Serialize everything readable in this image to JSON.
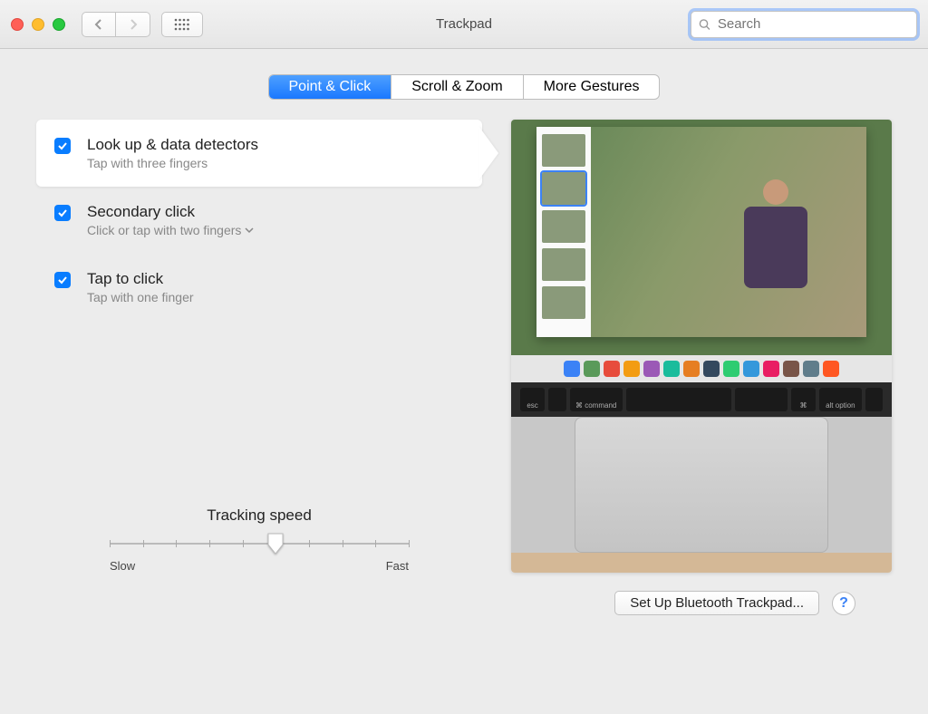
{
  "window": {
    "title": "Trackpad"
  },
  "search": {
    "placeholder": "Search"
  },
  "tabs": [
    {
      "label": "Point & Click",
      "active": true
    },
    {
      "label": "Scroll & Zoom",
      "active": false
    },
    {
      "label": "More Gestures",
      "active": false
    }
  ],
  "options": [
    {
      "title": "Look up & data detectors",
      "subtitle": "Tap with three fingers",
      "checked": true,
      "selected": true,
      "dropdown": false
    },
    {
      "title": "Secondary click",
      "subtitle": "Click or tap with two fingers",
      "checked": true,
      "selected": false,
      "dropdown": true
    },
    {
      "title": "Tap to click",
      "subtitle": "Tap with one finger",
      "checked": true,
      "selected": false,
      "dropdown": false
    }
  ],
  "speed": {
    "label": "Tracking speed",
    "min_label": "Slow",
    "max_label": "Fast",
    "ticks": 10,
    "value_index": 5
  },
  "preview": {
    "keyboard_keys": [
      "esc",
      "",
      "⌘ command",
      "",
      "",
      "⌘",
      "alt option",
      ""
    ],
    "dock_colors": [
      "#3b82f6",
      "#5a9a5a",
      "#e74c3c",
      "#f39c12",
      "#9b59b6",
      "#1abc9c",
      "#e67e22",
      "#34495e",
      "#2ecc71",
      "#3498db",
      "#e91e63",
      "#795548",
      "#607d8b",
      "#ff5722"
    ]
  },
  "footer": {
    "setup_button": "Set Up Bluetooth Trackpad...",
    "help_label": "?"
  }
}
